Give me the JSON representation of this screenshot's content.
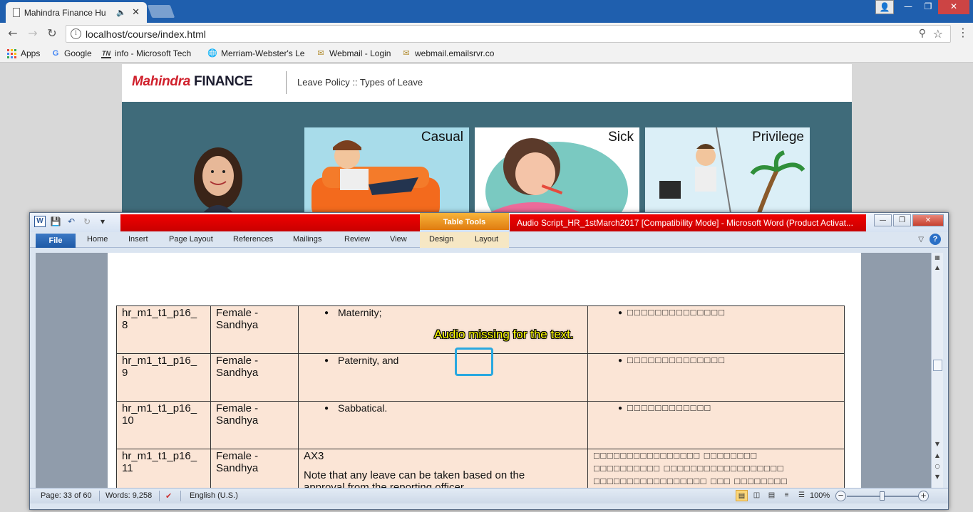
{
  "browser": {
    "tab_title": "Mahindra Finance Hu",
    "url": "localhost/course/index.html",
    "bookmarks": [
      {
        "label": "Apps",
        "icon": "apps-grid-icon"
      },
      {
        "label": "Google",
        "icon": "google-icon"
      },
      {
        "label": "info - Microsoft Tech",
        "icon": "technet-icon"
      },
      {
        "label": "Merriam-Webster's Le",
        "icon": "globe-icon"
      },
      {
        "label": "Webmail - Login",
        "icon": "mail-icon"
      },
      {
        "label": "webmail.emailsrvr.co",
        "icon": "mail-icon"
      }
    ]
  },
  "course": {
    "logo_brand": "Mahindra",
    "logo_word": "FINANCE",
    "breadcrumb": "Leave Policy :: Types of Leave",
    "cards": [
      {
        "title": "Casual"
      },
      {
        "title": "Sick"
      },
      {
        "title": "Privilege"
      }
    ]
  },
  "word": {
    "table_tools": "Table Tools",
    "title": "Audio Script_HR_1stMarch2017 [Compatibility Mode] - Microsoft Word (Product Activat...",
    "tabs": {
      "file": "File",
      "home": "Home",
      "insert": "Insert",
      "page_layout": "Page Layout",
      "references": "References",
      "mailings": "Mailings",
      "review": "Review",
      "view": "View",
      "design": "Design",
      "layout": "Layout"
    },
    "annotation": "Audio missing for the text.",
    "rows": [
      {
        "id_a": "hr_m1_t1_p16_",
        "id_b": "8",
        "speaker_a": "Female -",
        "speaker_b": "Sandhya",
        "text": "Maternity;",
        "translation": "□□□□□□□□□□□□□□"
      },
      {
        "id_a": "hr_m1_t1_p16_",
        "id_b": "9",
        "speaker_a": "Female -",
        "speaker_b": "Sandhya",
        "text": "Paternity, and",
        "translation": "□□□□□□□□□□□□□□"
      },
      {
        "id_a": "hr_m1_t1_p16_",
        "id_b": "10",
        "speaker_a": "Female -",
        "speaker_b": "Sandhya",
        "text": "Sabbatical.",
        "translation": "□□□□□□□□□□□□"
      },
      {
        "id_a": "hr_m1_t1_p16_",
        "id_b": "11",
        "speaker_a": "Female -",
        "speaker_b": "Sandhya",
        "text_title": "AX3",
        "text": "Note that any leave can be taken based on the",
        "text_cut": "approval from the reporting officer.",
        "translation_lines": [
          "□□□□□□□□□□□□□□□□   □□□□□□□□",
          "□□□□□□□□□□   □□□□□□□□□□□□□□□□□□",
          "□□□□□□□□□□□□□□□□□   □□□   □□□□□□□□"
        ]
      }
    ],
    "status": {
      "page": "Page: 33 of 60",
      "words": "Words: 9,258",
      "language": "English (U.S.)",
      "zoom": "100%"
    }
  },
  "colors": {
    "chrome_blue": "#1f5fae",
    "word_red": "#e00000",
    "table_tools_orange": "#f0a030",
    "cell_bg": "#fbe5d6",
    "highlight": "#29a8e0",
    "annotation": "#ffff00"
  }
}
